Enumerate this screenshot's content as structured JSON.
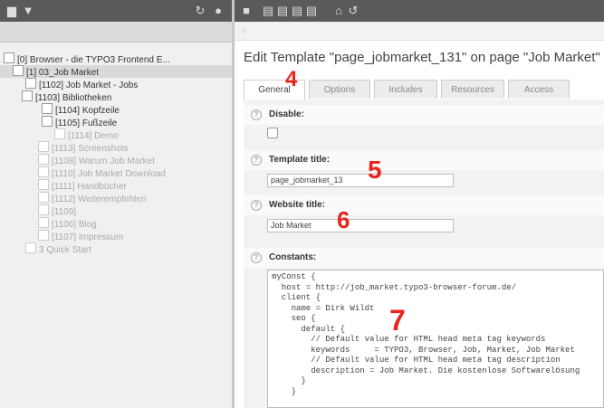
{
  "page_tree": {
    "items": [
      {
        "label": "[0] Browser - die TYPO3 Frontend E...",
        "faded": false,
        "selected": false
      },
      {
        "label": "[1] 03_Job Market",
        "faded": false,
        "selected": true
      },
      {
        "label": "[1102] Job Market - Jobs",
        "faded": false,
        "selected": false
      },
      {
        "label": "[1103] Bibliotheken",
        "faded": false,
        "selected": false
      },
      {
        "label": "[1104] Kopfzeile",
        "faded": false,
        "selected": false
      },
      {
        "label": "[1105] Fußzeile",
        "faded": false,
        "selected": false
      },
      {
        "label": "[1114] Demo",
        "faded": true,
        "selected": false
      },
      {
        "label": "[1113] Screenshots",
        "faded": true,
        "selected": false
      },
      {
        "label": "[1108] Warum Job Market",
        "faded": true,
        "selected": false
      },
      {
        "label": "[1110] Job Market Download",
        "faded": true,
        "selected": false
      },
      {
        "label": "[1111] Handbücher",
        "faded": true,
        "selected": false
      },
      {
        "label": "[1112] Weiterempfehlen",
        "faded": true,
        "selected": false
      },
      {
        "label": "[1109]",
        "faded": true,
        "selected": false
      },
      {
        "label": "[1106] Blog",
        "faded": true,
        "selected": false
      },
      {
        "label": "[1107] Impressum",
        "faded": true,
        "selected": false
      },
      {
        "label": "3  Quick Start",
        "faded": true,
        "selected": false
      }
    ]
  },
  "editor": {
    "title": "Edit Template \"page_jobmarket_131\" on page \"Job Market\"",
    "tabs": [
      "General",
      "Options",
      "Includes",
      "Resources",
      "Access"
    ],
    "fields": {
      "disable_label": "Disable:",
      "template_title_label": "Template title:",
      "template_title_value": "page_jobmarket_13",
      "website_title_label": "Website title:",
      "website_title_value": "Job Market",
      "constants_label": "Constants:",
      "constants_code": "myConst {\n  host = http://job_market.typo3-browser-forum.de/\n  client {\n    name = Dirk Wildt\n    seo {\n      default {\n        // Default value for HTML head meta tag keywords\n        keywords     = TYPO3, Browser, Job, Market, Job Market\n        // Default value for HTML head meta tag description\n        description = Job Market. Die kostenlose Softwarelösung\n      }\n    }"
    }
  },
  "annotations": {
    "tabs": "4",
    "template_title": "5",
    "website_title": "6",
    "constants": "7"
  }
}
